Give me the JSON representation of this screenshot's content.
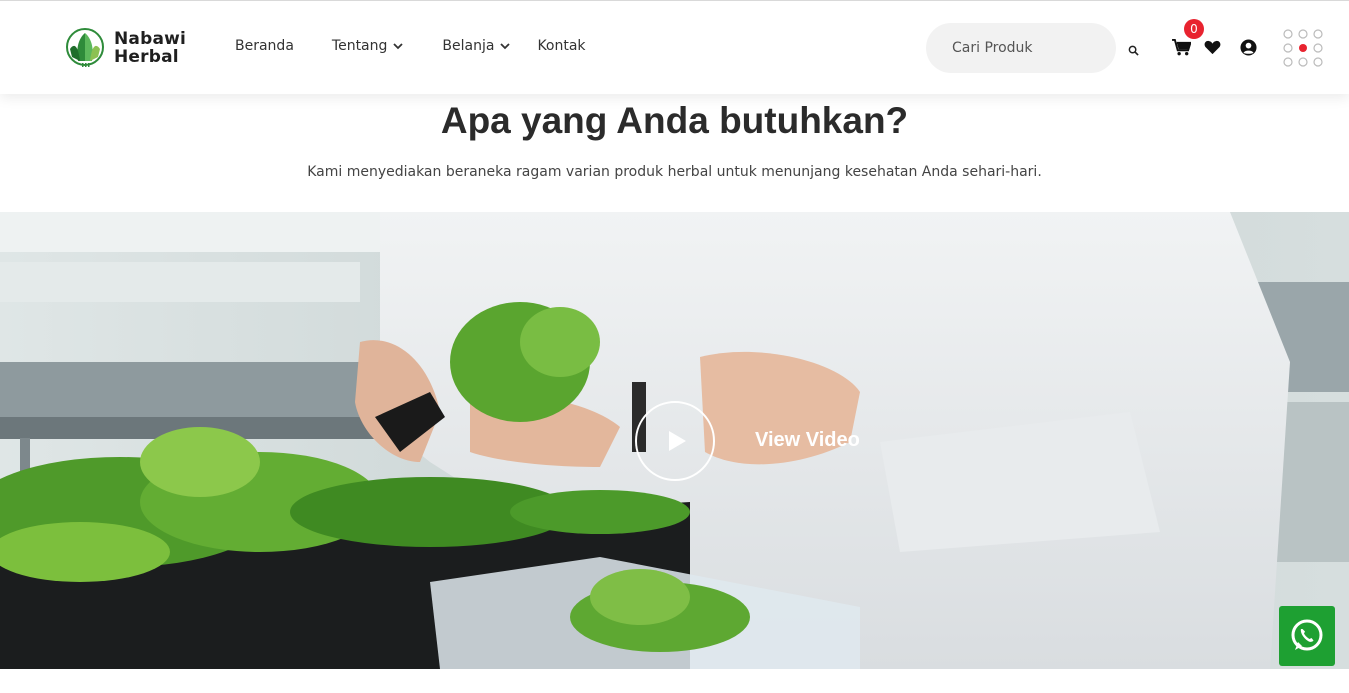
{
  "brand": {
    "line1": "Nabawi",
    "line2": "Herbal"
  },
  "nav": {
    "items": [
      {
        "label": "Beranda",
        "has_dropdown": false
      },
      {
        "label": "Tentang",
        "has_dropdown": true
      },
      {
        "label": "Belanja",
        "has_dropdown": true
      },
      {
        "label": "Kontak",
        "has_dropdown": false
      }
    ]
  },
  "search": {
    "placeholder": "Cari Produk",
    "icon": "search-icon"
  },
  "cart": {
    "count": "0",
    "icon": "cart-icon",
    "badge_color": "#e8232f"
  },
  "icons": {
    "wishlist": "heart-icon",
    "account": "user-circle-icon",
    "menu": "dots-grid-icon"
  },
  "hero": {
    "title": "Apa yang Anda butuhkan?",
    "subtitle": "Kami menyediakan beraneka ragam varian produk herbal untuk menunjang kesehatan Anda sehari-hari."
  },
  "video": {
    "cta_label": "View Video",
    "play_icon": "play-icon"
  },
  "floating": {
    "whatsapp_icon": "whatsapp-icon",
    "whatsapp_color": "#1ea032"
  }
}
